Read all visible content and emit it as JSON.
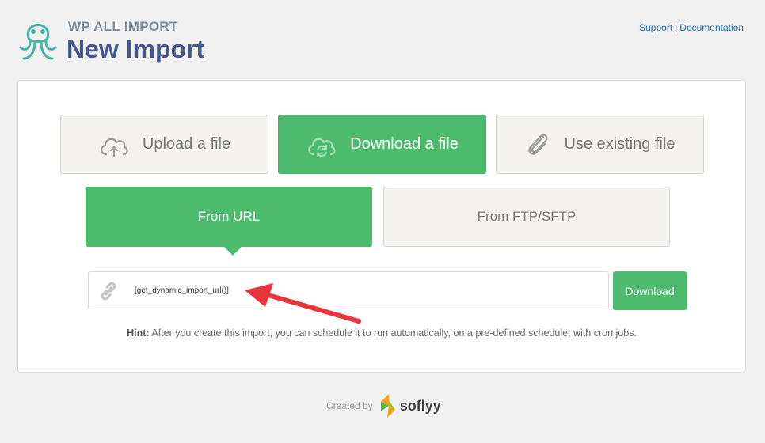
{
  "header": {
    "brand_small": "WP ALL IMPORT",
    "title": "New Import",
    "support_link": "Support",
    "separator": "|",
    "docs_link": "Documentation"
  },
  "import_options": [
    {
      "label": "Upload a file",
      "icon": "cloud-upload-icon",
      "selected": false
    },
    {
      "label": "Download a file",
      "icon": "cloud-sync-icon",
      "selected": true
    },
    {
      "label": "Use existing file",
      "icon": "paperclip-icon",
      "selected": false
    }
  ],
  "download_sources": [
    {
      "label": "From URL",
      "selected": true
    },
    {
      "label": "From FTP/SFTP",
      "selected": false
    }
  ],
  "url_input": {
    "value": "[get_dynamic_import_url()]",
    "icon": "link-icon"
  },
  "download_button": "Download",
  "hint": {
    "label": "Hint:",
    "text": " After you create this import, you can schedule it to run automatically, on a pre-defined schedule, with cron jobs."
  },
  "footer": {
    "created_by": "Created by",
    "company": "soflyy"
  },
  "colors": {
    "accent_green": "#4cbb6e",
    "title_blue": "#40598a",
    "arrow_red": "#e8343a"
  }
}
